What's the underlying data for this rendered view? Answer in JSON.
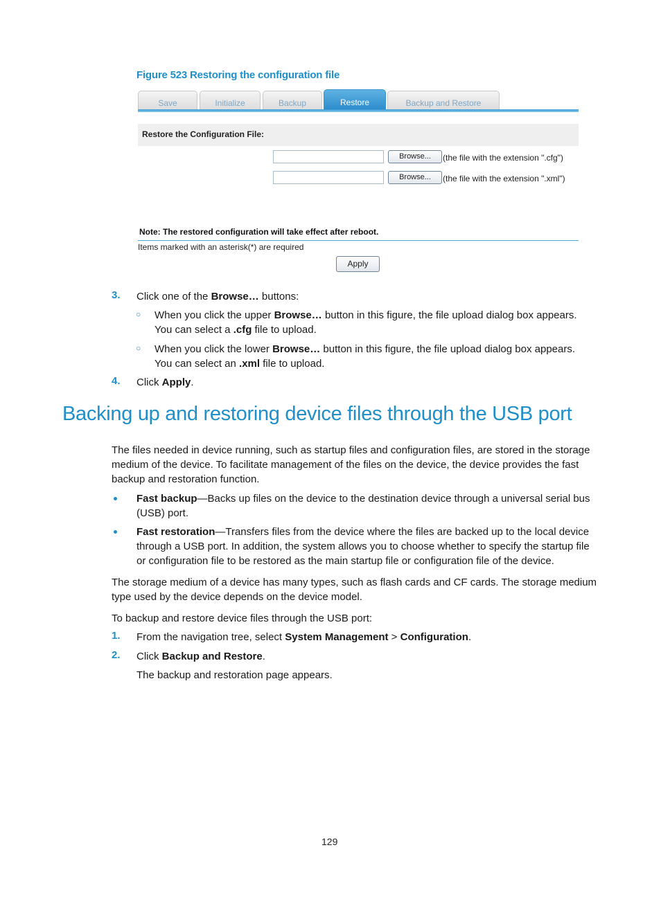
{
  "figure": {
    "caption": "Figure 523 Restoring the configuration file",
    "tabs": [
      {
        "label": "Save",
        "active": false
      },
      {
        "label": "Initialize",
        "active": false
      },
      {
        "label": "Backup",
        "active": false
      },
      {
        "label": "Restore",
        "active": true
      },
      {
        "label": "Backup and Restore",
        "active": false
      }
    ],
    "section_title": "Restore the Configuration File:",
    "file_rows": [
      {
        "value": "",
        "browse_label": "Browse...",
        "hint": "(the file with the extension \".cfg\")"
      },
      {
        "value": "",
        "browse_label": "Browse...",
        "hint": "(the file with the extension \".xml\")"
      }
    ],
    "note": "Note: The restored configuration will take effect after reboot.",
    "required_note": "Items marked with an asterisk(*) are required",
    "apply_label": "Apply",
    "colors": {
      "accent": "#1f8fc9",
      "active_tab": "#2b8ccc",
      "section_band": "#efefef"
    }
  },
  "steps_a": {
    "step3": {
      "num": "3.",
      "pre": "Click one of the ",
      "bold": "Browse…",
      "post": " buttons:",
      "subitems": [
        {
          "marker": "○",
          "pre": "When you click the upper ",
          "bold": "Browse…",
          "post": " button in this figure, the file upload dialog box appears.",
          "line2_pre": "You can select a ",
          "line2_bold": ".cfg",
          "line2_post": " file to upload."
        },
        {
          "marker": "○",
          "pre": "When you click the lower ",
          "bold": "Browse…",
          "post": " button in this figure, the file upload dialog box appears.",
          "line2_pre": "You can select an ",
          "line2_bold": ".xml",
          "line2_post": " file to upload."
        }
      ]
    },
    "step4": {
      "num": "4.",
      "pre": "Click ",
      "bold": "Apply",
      "post": "."
    }
  },
  "section": {
    "heading": "Backing up and restoring device files through the USB port",
    "intro": [
      "The files needed in device running, such as startup files and configuration files, are stored in the storage",
      "medium of the device. To facilitate management of the files on the device, the device provides the fast",
      "backup and restoration function."
    ],
    "bullets": [
      {
        "bold": "Fast backup",
        "lines": [
          "—Backs up files on the device to the destination device through a universal serial bus",
          "(USB) port."
        ]
      },
      {
        "bold": "Fast restoration",
        "lines": [
          "—Transfers files from the device where the files are backed up to the local device",
          "through a USB port. In addition, the system allows you to choose whether to specify the startup file",
          "or configuration file to be restored as the main startup file or configuration file of the device."
        ]
      }
    ],
    "storage_para": [
      "The storage medium of a device has many types, such as flash cards and CF cards. The storage medium",
      "type used by the device depends on the device model."
    ],
    "procedure_intro": "To backup and restore device files through the USB port:",
    "steps": [
      {
        "num": "1.",
        "pre": "From the navigation tree, select ",
        "bold1": "System Management",
        "mid": " > ",
        "bold2": "Configuration",
        "post": "."
      },
      {
        "num": "2.",
        "pre": "Click ",
        "bold1": "Backup and Restore",
        "post": ".",
        "result": "The backup and restoration page appears."
      }
    ]
  },
  "page_number": "129"
}
